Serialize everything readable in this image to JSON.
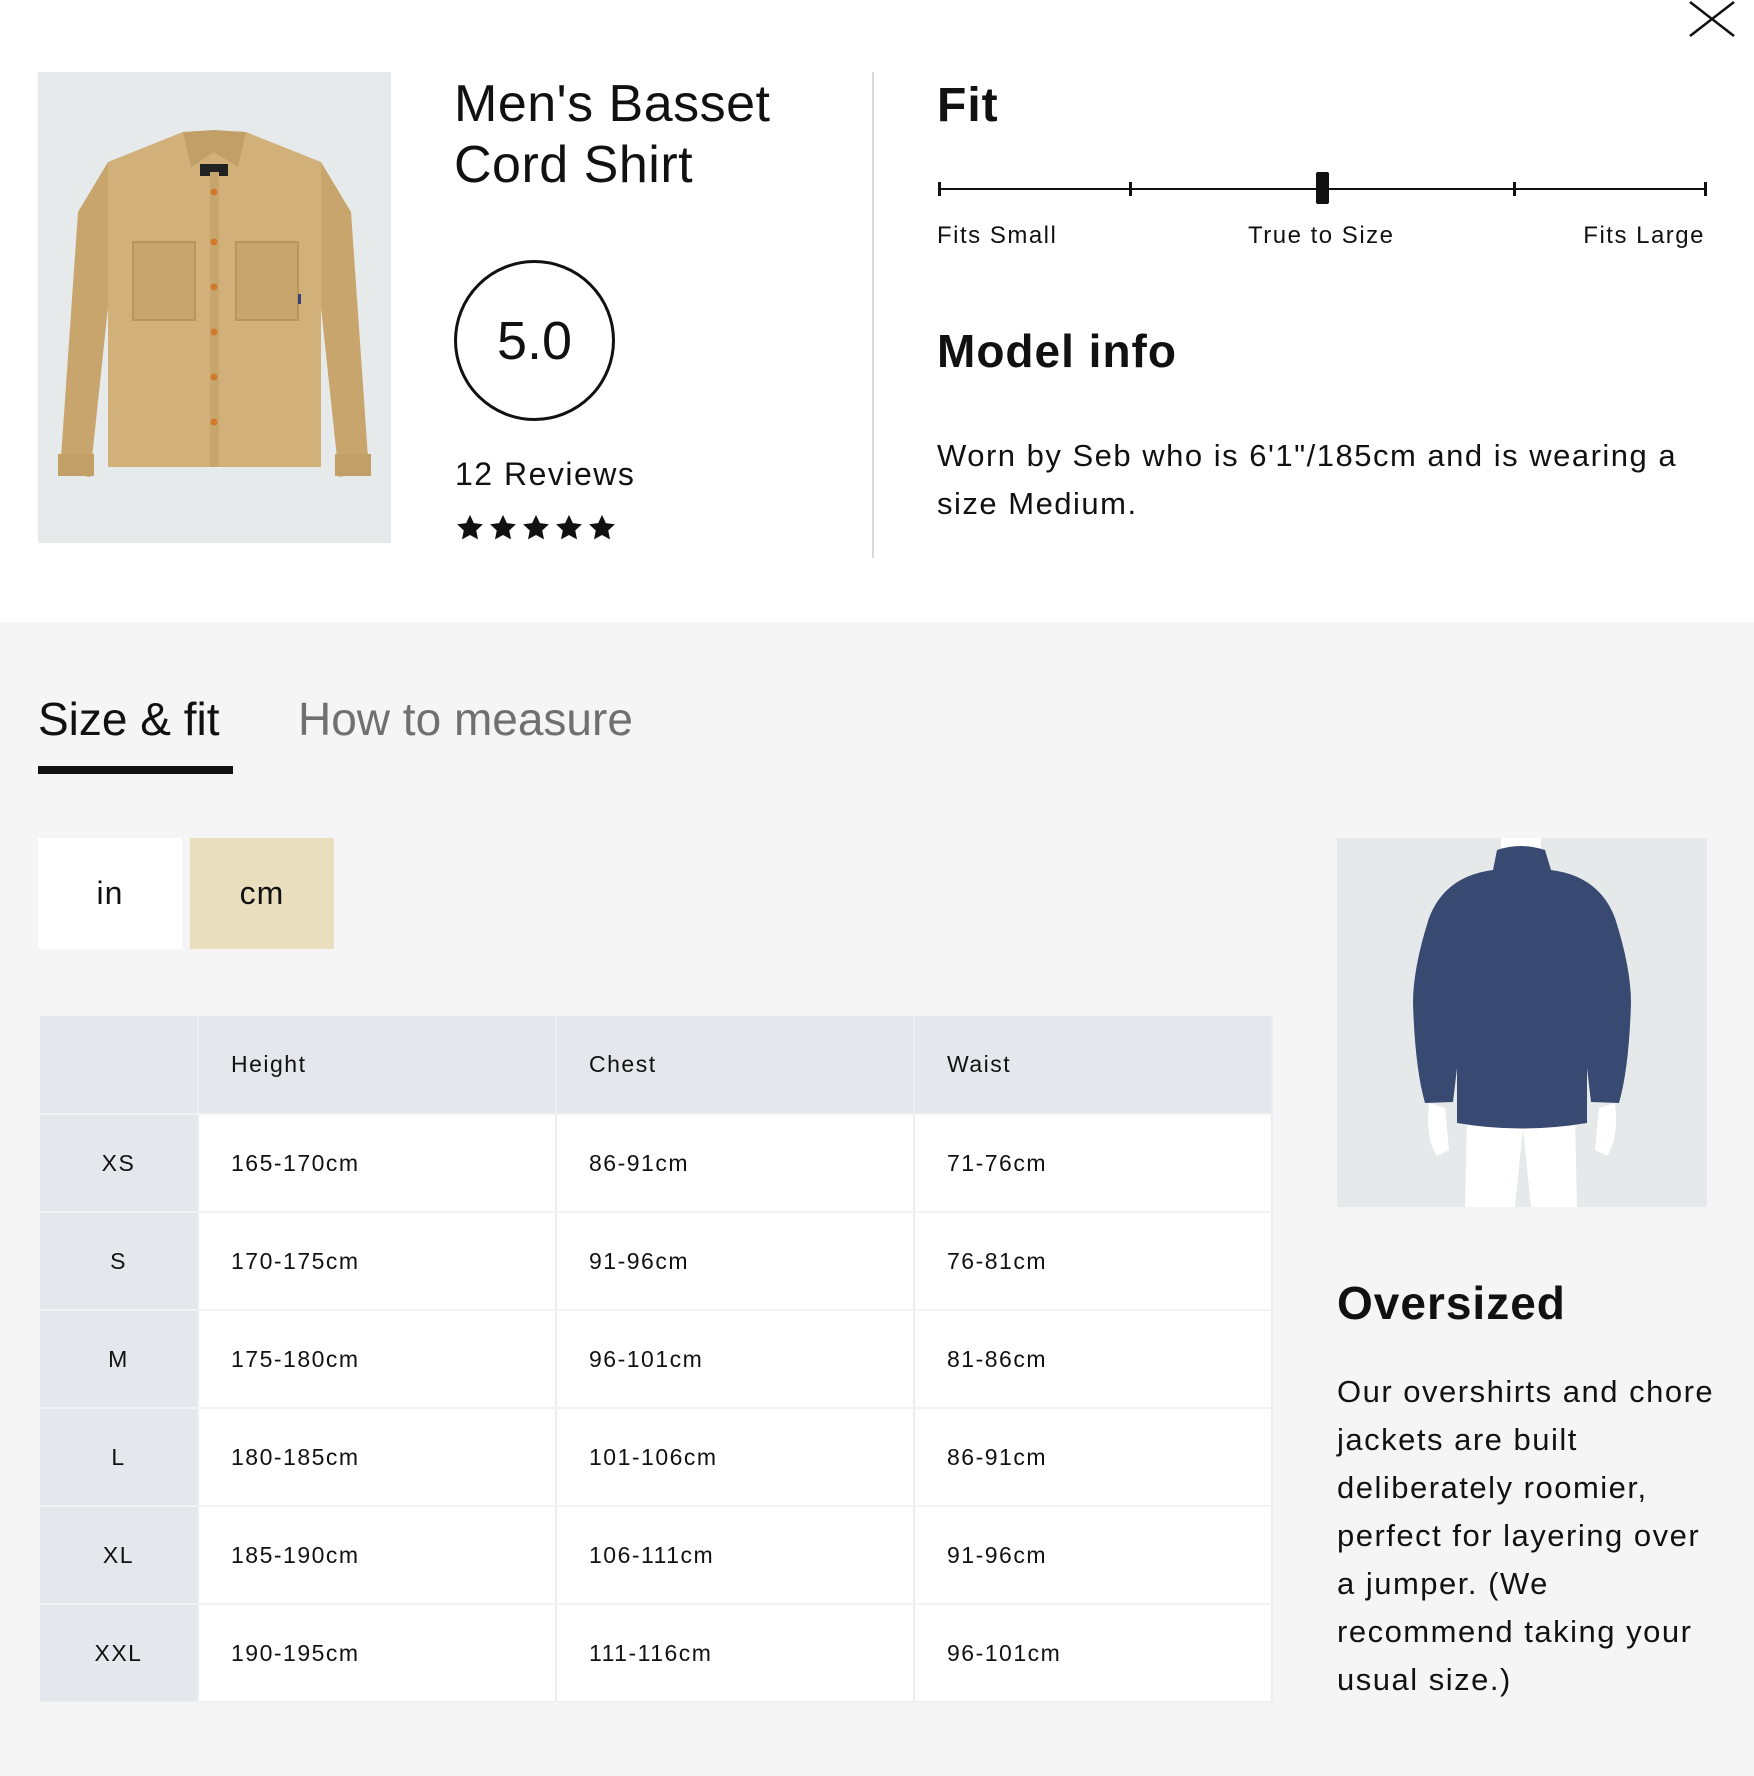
{
  "product": {
    "title_line1": "Men's Basset",
    "title_line2": "Cord Shirt",
    "rating": "5.0",
    "reviews_label": "12 Reviews",
    "stars": 5,
    "image_icon": "shirt-image"
  },
  "fit": {
    "heading": "Fit",
    "scale_labels": [
      "Fits Small",
      "True to Size",
      "Fits Large"
    ],
    "scale_value": 0.5
  },
  "model_info": {
    "heading": "Model info",
    "text": "Worn by Seb who is 6'1\"/185cm and is wearing a size Medium."
  },
  "tabs": [
    {
      "label": "Size & fit",
      "active": true
    },
    {
      "label": "How to measure",
      "active": false
    }
  ],
  "units": [
    {
      "label": "in",
      "active": false
    },
    {
      "label": "cm",
      "active": true
    }
  ],
  "size_table": {
    "headers": [
      "",
      "Height",
      "Chest",
      "Waist"
    ],
    "rows": [
      [
        "XS",
        "165-170cm",
        "86-91cm",
        "71-76cm"
      ],
      [
        "S",
        "170-175cm",
        "91-96cm",
        "76-81cm"
      ],
      [
        "M",
        "175-180cm",
        "96-101cm",
        "81-86cm"
      ],
      [
        "L",
        "180-185cm",
        "101-106cm",
        "86-91cm"
      ],
      [
        "XL",
        "185-190cm",
        "106-111cm",
        "91-96cm"
      ],
      [
        "XXL",
        "190-195cm",
        "111-116cm",
        "96-101cm"
      ]
    ]
  },
  "fit_type": {
    "title": "Oversized",
    "text": "Our overshirts and chore jackets are built deliberately roomier, perfect for layering over a jumper. (We recommend taking your usual size.)",
    "image_icon": "oversized-silhouette"
  },
  "colors": {
    "active_unit_bg": "#e9dfbf",
    "shirt_tan": "#d2b07a",
    "silhouette_navy": "#384a72",
    "table_header_bg": "#e4e7eb",
    "bottom_bg": "#f5f5f5"
  },
  "icons": {
    "close": "close-icon",
    "star": "star-icon"
  }
}
